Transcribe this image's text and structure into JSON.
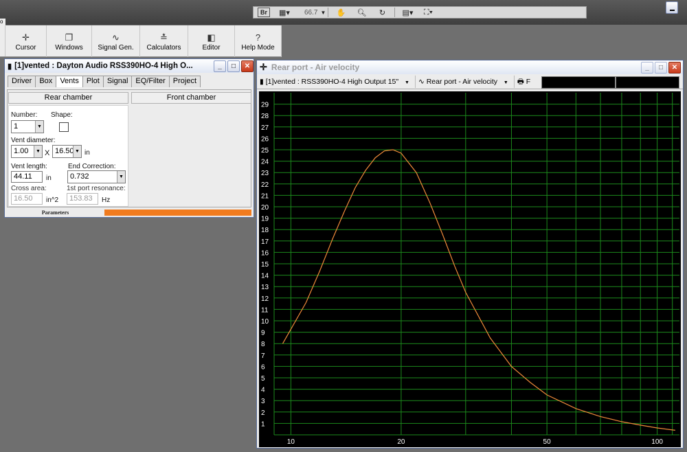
{
  "topbar": {
    "br_label": "Br",
    "zoom": "66.7"
  },
  "toolbar": {
    "buttons": [
      {
        "label": "Cursor",
        "icon": "crosshair-icon"
      },
      {
        "label": "Windows",
        "icon": "windows-icon"
      },
      {
        "label": "Signal Gen.",
        "icon": "sine-wave-icon"
      },
      {
        "label": "Calculators",
        "icon": "calculator-icon"
      },
      {
        "label": "Editor",
        "icon": "speaker-icon"
      },
      {
        "label": "Help Mode",
        "icon": "question-icon"
      }
    ]
  },
  "left_window": {
    "title": "[1]vented : Dayton Audio RSS390HO-4 High O...",
    "tabs": [
      "Driver",
      "Box",
      "Vents",
      "Plot",
      "Signal",
      "EQ/Filter",
      "Project"
    ],
    "active_tab": "Vents",
    "rear_chamber": "Rear chamber",
    "front_chamber": "Front chamber",
    "number_label": "Number:",
    "number_value": "1",
    "shape_label": "Shape:",
    "vent_diameter_label": "Vent diameter:",
    "vent_diameter_a": "1.00",
    "vent_diameter_x": "X",
    "vent_diameter_b": "16.50",
    "vent_diameter_unit": "in",
    "vent_length_label": "Vent length:",
    "vent_length_value": "44.11",
    "vent_length_unit": "in",
    "end_correction_label": "End Correction:",
    "end_correction_value": "0.732",
    "cross_area_label": "Cross area:",
    "cross_area_value": "16.50",
    "cross_area_unit": "in^2",
    "port_resonance_label": "1st port resonance:",
    "port_resonance_value": "153.83",
    "port_resonance_unit": "Hz",
    "status_label": "Parameters",
    "accent": "#f07b1f"
  },
  "graph_window": {
    "title": "Rear port - Air velocity",
    "source_select": "[1]vented : RSS390HO-4 High Output 15\"",
    "graph_select": "Rear port - Air velocity",
    "print_label": "F"
  },
  "chart_data": {
    "type": "line",
    "title": "",
    "xlabel": "",
    "ylabel": "",
    "x_scale": "log",
    "xlim": [
      9,
      115
    ],
    "ylim": [
      0,
      30
    ],
    "x_ticks": [
      10,
      20,
      50,
      100
    ],
    "y_ticks": [
      1,
      2,
      3,
      4,
      5,
      6,
      7,
      8,
      9,
      10,
      11,
      12,
      13,
      14,
      15,
      16,
      17,
      18,
      19,
      20,
      21,
      22,
      23,
      24,
      25,
      26,
      27,
      28,
      29
    ],
    "grid": true,
    "background": "#000000",
    "grid_color": "#1c8a1c",
    "line_color": "#f08a3a",
    "series": [
      {
        "x": [
          9.5,
          11,
          12,
          13,
          14,
          15,
          16,
          17,
          18,
          19,
          20,
          22,
          24,
          26,
          28,
          30,
          35,
          40,
          45,
          50,
          60,
          70,
          80,
          90,
          100,
          112
        ],
        "values": [
          8.0,
          11.6,
          14.4,
          17.2,
          19.6,
          21.7,
          23.2,
          24.3,
          24.9,
          25.0,
          24.7,
          23.0,
          20.3,
          17.5,
          14.8,
          12.5,
          8.5,
          6.0,
          4.6,
          3.5,
          2.3,
          1.6,
          1.15,
          0.85,
          0.6,
          0.4
        ]
      }
    ]
  }
}
